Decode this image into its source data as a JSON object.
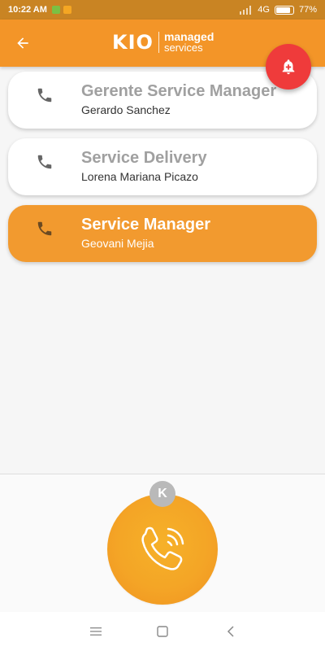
{
  "status_bar": {
    "time": "10:22 AM",
    "network": "4G",
    "battery": "77%",
    "battery_level": 0.77
  },
  "app_bar": {
    "logo_mark": "KIO",
    "logo_line1": "managed",
    "logo_line2": "services"
  },
  "contacts": [
    {
      "role": "Gerente Service Manager",
      "name": "Gerardo Sanchez",
      "active": false
    },
    {
      "role": "Service Delivery",
      "name": "Lorena Mariana Picazo",
      "active": false
    },
    {
      "role": "Service Manager",
      "name": "Geovani Mejia",
      "active": true
    }
  ],
  "call": {
    "badge": "K"
  },
  "colors": {
    "primary": "#f39528",
    "status_bar": "#c98423",
    "alert": "#ef3b3b",
    "active_card": "#f29a2f"
  },
  "icons": {
    "back": "arrow-left-icon",
    "alert": "bell-plus-icon",
    "contact": "phone-icon",
    "call": "phone-ringing-icon",
    "nav_menu": "menu-icon",
    "nav_home": "square-icon",
    "nav_back": "chevron-left-icon"
  }
}
